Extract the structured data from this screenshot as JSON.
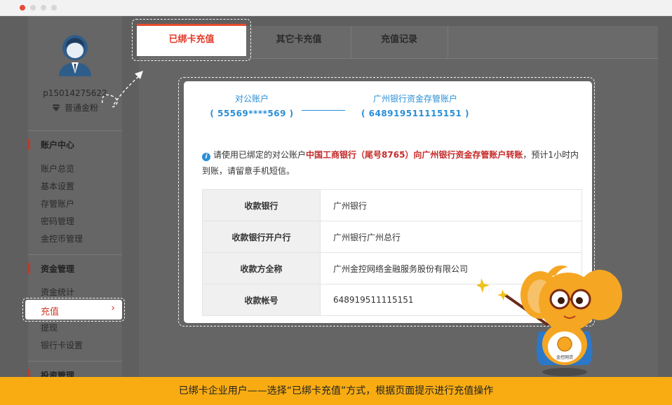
{
  "sidebar": {
    "username": "p15014275622",
    "level": "普通金粉",
    "sections": [
      {
        "title": "账户中心",
        "items": [
          "账户总览",
          "基本设置",
          "存管账户",
          "密码管理",
          "金控币管理"
        ]
      },
      {
        "title": "资金管理",
        "items": [
          "资金统计",
          "充值",
          "提现",
          "银行卡设置"
        ]
      },
      {
        "title": "投资管理",
        "items": []
      }
    ],
    "active_item": "充值",
    "active_chevron": "›"
  },
  "tabs": [
    "已绑卡充值",
    "其它卡充值",
    "充值记录"
  ],
  "card": {
    "from": {
      "label": "对公账户",
      "number": "( 55569****569 )"
    },
    "to": {
      "label": "广州银行资金存管账户",
      "number": "( 648919511115151 )"
    },
    "notice": {
      "pre": "请使用已绑定的对公账户",
      "highlight": "中国工商银行（尾号8765）向广州银行资金存管账户转账",
      "post": "，预计1小时内到账，请留意手机短信。"
    },
    "rows": [
      {
        "key": "收款银行",
        "value": "广州银行"
      },
      {
        "key": "收款银行开户行",
        "value": "广州银行广州总行"
      },
      {
        "key": "收款方全称",
        "value": "广州金控网络金融服务股份有限公司"
      },
      {
        "key": "收款帐号",
        "value": "648919511115151"
      }
    ]
  },
  "mascot_badge": "金控网贷",
  "caption": "已绑卡企业用户——选择“已绑卡充值”方式，根据页面提示进行充值操作",
  "colors": {
    "accent": "#e23b28",
    "link": "#2a8fd6",
    "caption_bg": "#f8ac12"
  }
}
